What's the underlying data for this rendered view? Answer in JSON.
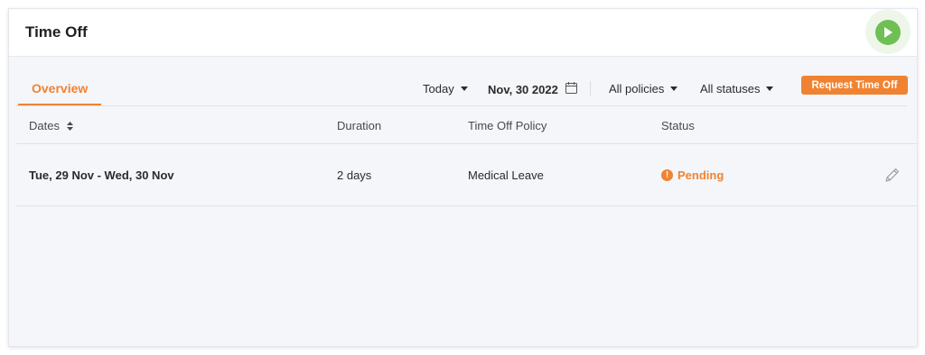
{
  "header": {
    "title": "Time Off",
    "play_button": "play-icon"
  },
  "tabs": [
    {
      "label": "Overview",
      "active": true
    }
  ],
  "filters": {
    "range": "Today",
    "date": "Nov, 30 2022",
    "policies": "All policies",
    "statuses": "All statuses"
  },
  "actions": {
    "request_label": "Request Time Off"
  },
  "table": {
    "columns": [
      "Dates",
      "Duration",
      "Time Off Policy",
      "Status"
    ],
    "rows": [
      {
        "dates": "Tue, 29 Nov - Wed, 30 Nov",
        "duration": "2 days",
        "policy": "Medical Leave",
        "status": "Pending",
        "status_icon": "!"
      }
    ]
  },
  "colors": {
    "accent": "#f08332",
    "play": "#6fbf55",
    "background": "#f4f6fa"
  }
}
